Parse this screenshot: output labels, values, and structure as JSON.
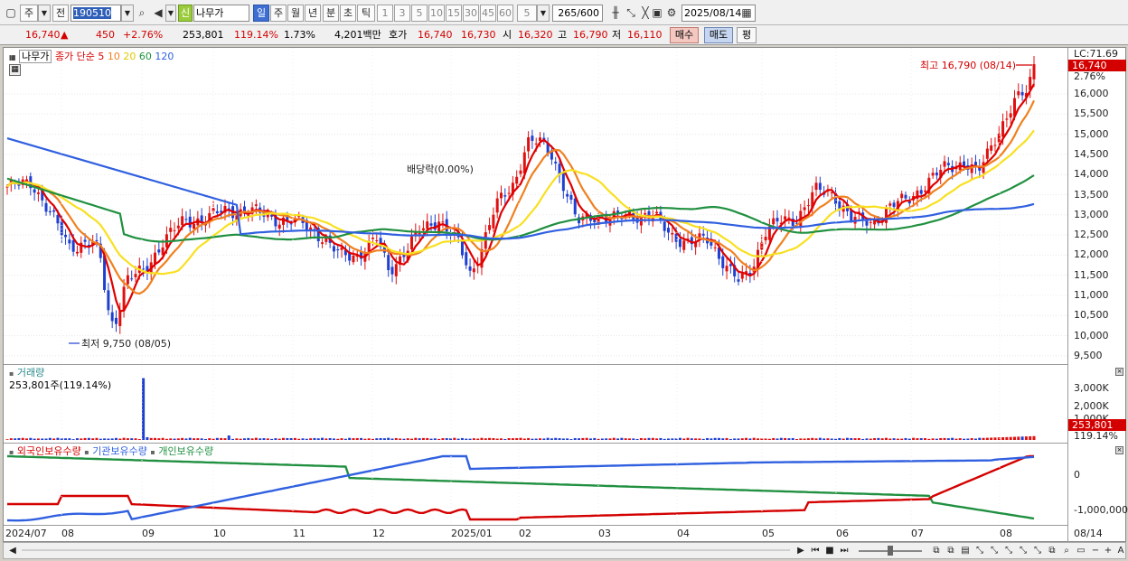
{
  "toolbar": {
    "btn_weekly": "주",
    "btn_prev": "전",
    "stock_code": "190510",
    "new_label": "신",
    "stock_name": "나무가",
    "periods": [
      "일",
      "주",
      "월",
      "년",
      "분",
      "초",
      "틱"
    ],
    "intervals": [
      "1",
      "3",
      "5",
      "10",
      "15",
      "30",
      "45",
      "60"
    ],
    "interval_value": "5",
    "count": "265/600",
    "date": "2025/08/14"
  },
  "quote": {
    "price": "16,740",
    "arrow": "▲",
    "change": "450",
    "change_pct": "+2.76%",
    "volume": "253,801",
    "volume_ratio": "119.14%",
    "turnover": "1.73%",
    "amount": "4,201백만",
    "ask_label": "호가",
    "ask": "16,740",
    "bid": "16,730",
    "open_label": "시",
    "open": "16,320",
    "high_label": "고",
    "high": "16,790",
    "low_label": "저",
    "low": "16,110",
    "buy_label": "매수",
    "sell_label": "매도",
    "avg_label": "평"
  },
  "price_pane": {
    "stock_label": "나무가",
    "legend_title": "종가 단순",
    "ma_labels": [
      "5",
      "10",
      "20",
      "60",
      "120"
    ],
    "ma_colors": [
      "#e00000",
      "#f08020",
      "#f8e020",
      "#209040",
      "#3060e0"
    ],
    "lc_label": "LC:71.69",
    "last_price_tag": "16,740",
    "last_pct_tag": "2.76%",
    "high_annotation": "최고 16,790 (08/14)",
    "low_annotation": "최저 9,750 (08/05)",
    "dividend_annotation": "배당락(0.00%)",
    "y_ticks": [
      "16,000",
      "15,500",
      "15,000",
      "14,500",
      "14,000",
      "13,500",
      "13,000",
      "12,500",
      "12,000",
      "11,500",
      "11,000",
      "10,500",
      "10,000",
      "9,500"
    ]
  },
  "volume_pane": {
    "title": "거래량",
    "current": "253,801주(119.14%)",
    "y_ticks": [
      "3,000K",
      "2,000K",
      "1,000K"
    ],
    "tag_value": "253,801",
    "tag_pct": "119.14%"
  },
  "holding_pane": {
    "legend": [
      "외국인보유수량",
      "기관보유수량",
      "개인보유수량"
    ],
    "colors": [
      "#d40000",
      "#3060e0",
      "#209040"
    ],
    "y_ticks": [
      "0",
      "-1,000,000"
    ]
  },
  "x_axis": {
    "labels": [
      "2024/07",
      "08",
      "09",
      "10",
      "11",
      "12",
      "2025/01",
      "02",
      "03",
      "04",
      "05",
      "06",
      "07",
      "08"
    ],
    "last_date": "08/14"
  },
  "chart_data": {
    "type": "candlestick",
    "title": "나무가",
    "y_range": [
      9500,
      16800
    ],
    "monthly_closes": {
      "x": [
        "2024/07",
        "2024/08",
        "2024/09",
        "2024/10",
        "2024/11",
        "2024/12",
        "2025/01",
        "2025/02",
        "2025/03",
        "2025/04",
        "2025/05",
        "2025/06",
        "2025/07",
        "2025/08"
      ],
      "close": [
        13800,
        12000,
        13000,
        13000,
        12000,
        12500,
        14700,
        12900,
        12600,
        12500,
        13500,
        13300,
        13800,
        16740
      ]
    },
    "high": 16790,
    "high_date": "08/14",
    "low": 9750,
    "low_date": "08/05"
  }
}
